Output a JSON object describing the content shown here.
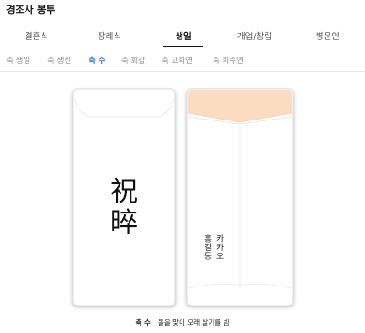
{
  "app": {
    "title": "경조사 봉투"
  },
  "tabs": [
    {
      "label": "결혼식",
      "active": false
    },
    {
      "label": "장례식",
      "active": false
    },
    {
      "label": "생일",
      "active": true
    },
    {
      "label": "개업/창립",
      "active": false
    },
    {
      "label": "병문안",
      "active": false
    }
  ],
  "subtabs": [
    {
      "label": "축 생일",
      "active": false
    },
    {
      "label": "축 생신",
      "active": false
    },
    {
      "label": "축 수",
      "active": true
    },
    {
      "label": "축 회갑",
      "active": false
    },
    {
      "label": "축 고희연",
      "active": false
    },
    {
      "label": "축 희수연",
      "active": false
    }
  ],
  "envelope_front": {
    "line1": "祝",
    "line2": "晬"
  },
  "envelope_back": {
    "name": "홍길동",
    "company": "카카오",
    "flap_color": "#fcdcc0"
  },
  "caption": {
    "title": "축 수",
    "meaning": "돌을 맞이 오래 살기를 빔"
  }
}
